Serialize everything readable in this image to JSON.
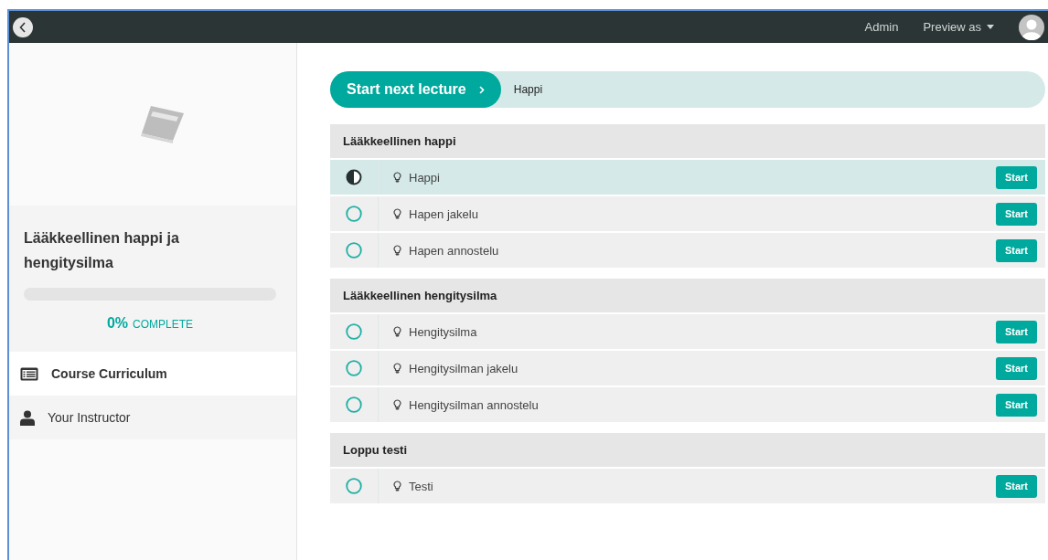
{
  "topbar": {
    "links": [
      "Admin"
    ],
    "preview": "Preview as"
  },
  "sidebar": {
    "course_title": "Lääkkeellinen happi ja hengitysilma",
    "progress": {
      "level": 0,
      "percent": "0%",
      "label": "COMPLETE"
    },
    "nav": [
      {
        "label": "Course Curriculum",
        "kind": "list",
        "selected": true
      },
      {
        "label": "Your Instructor",
        "kind": "person",
        "selected": false
      }
    ]
  },
  "next_lecture": {
    "button": "Start next lecture",
    "lecture": "Happi"
  },
  "sections": [
    {
      "title": "Lääkkeellinen happi",
      "lectures": [
        {
          "title": "Happi",
          "kind": "in_progress",
          "current": true,
          "button": "Start"
        },
        {
          "title": "Hapen jakelu",
          "kind": "not_started",
          "current": false,
          "button": "Start"
        },
        {
          "title": "Hapen annostelu",
          "kind": "not_started",
          "current": false,
          "button": "Start"
        }
      ]
    },
    {
      "title": "Lääkkeellinen hengitysilma",
      "lectures": [
        {
          "title": "Hengitysilma",
          "kind": "not_started",
          "current": false,
          "button": "Start"
        },
        {
          "title": "Hengitysilman jakelu",
          "kind": "not_started",
          "current": false,
          "button": "Start"
        },
        {
          "title": "Hengitysilman annostelu",
          "kind": "not_started",
          "current": false,
          "button": "Start"
        }
      ]
    },
    {
      "title": "Loppu testi",
      "lectures": [
        {
          "title": "Testi",
          "kind": "not_started",
          "current": false,
          "button": "Start"
        }
      ]
    }
  ]
}
